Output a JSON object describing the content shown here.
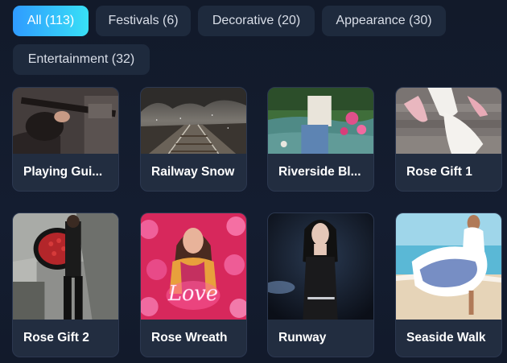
{
  "filters": [
    {
      "label": "All (113)",
      "active": true
    },
    {
      "label": "Festivals (6)",
      "active": false
    },
    {
      "label": "Decorative (20)",
      "active": false
    },
    {
      "label": "Appearance (30)",
      "active": false
    },
    {
      "label": "Entertainment (32)",
      "active": false
    }
  ],
  "cards": [
    {
      "title": "Playing Gui..."
    },
    {
      "title": "Railway Snow"
    },
    {
      "title": "Riverside Bl..."
    },
    {
      "title": "Rose Gift 1"
    },
    {
      "title": "Rose Gift 2"
    },
    {
      "title": "Rose Wreath"
    },
    {
      "title": "Runway"
    },
    {
      "title": "Seaside Walk"
    }
  ],
  "accent_gradient": [
    "#2f9bff",
    "#38e0f6"
  ],
  "background_color": "#131b2c",
  "card_color": "#222d40",
  "love_sign_text": "Love"
}
